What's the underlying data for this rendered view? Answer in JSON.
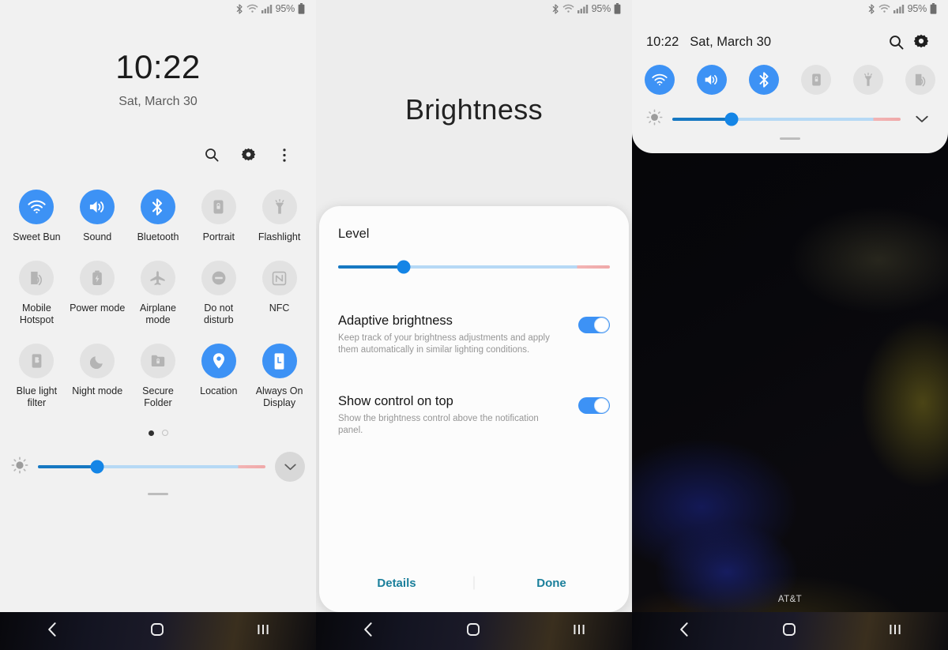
{
  "statusbar": {
    "battery_percent": "95%",
    "icons": [
      "bluetooth-icon",
      "wifi-icon",
      "signal-icon",
      "battery-icon"
    ]
  },
  "panel1": {
    "name": "expanded-quick-settings",
    "clock_time": "10:22",
    "clock_date": "Sat, March 30",
    "actions": [
      {
        "name": "search-icon",
        "label": "Search"
      },
      {
        "name": "gear-icon",
        "label": "Settings"
      },
      {
        "name": "overflow-menu-icon",
        "label": "More options"
      }
    ],
    "tiles": [
      {
        "label": "Sweet Bun",
        "icon": "wifi-icon",
        "on": true
      },
      {
        "label": "Sound",
        "icon": "sound-icon",
        "on": true
      },
      {
        "label": "Bluetooth",
        "icon": "bluetooth-icon",
        "on": true
      },
      {
        "label": "Portrait",
        "icon": "rotation-lock-icon",
        "on": false
      },
      {
        "label": "Flashlight",
        "icon": "flashlight-icon",
        "on": false
      },
      {
        "label": "Mobile Hotspot",
        "icon": "hotspot-icon",
        "on": false
      },
      {
        "label": "Power mode",
        "icon": "power-mode-icon",
        "on": false
      },
      {
        "label": "Airplane mode",
        "icon": "airplane-icon",
        "on": false
      },
      {
        "label": "Do not disturb",
        "icon": "do-not-disturb-icon",
        "on": false
      },
      {
        "label": "NFC",
        "icon": "nfc-icon",
        "on": false
      },
      {
        "label": "Blue light filter",
        "icon": "blue-light-filter-icon",
        "on": false
      },
      {
        "label": "Night mode",
        "icon": "moon-icon",
        "on": false
      },
      {
        "label": "Secure Folder",
        "icon": "secure-folder-icon",
        "on": false
      },
      {
        "label": "Location",
        "icon": "location-pin-icon",
        "on": true
      },
      {
        "label": "Always On Display",
        "icon": "always-on-display-icon",
        "on": true
      }
    ],
    "page_dots": {
      "count": 2,
      "active_index": 0
    },
    "brightness": {
      "value_percent": 26,
      "icon": "brightness-icon"
    },
    "expand_button": {
      "name": "expand-chevron-down-icon"
    }
  },
  "panel2": {
    "name": "brightness-dialog",
    "title": "Brightness",
    "level_label": "Level",
    "level_percent": 24,
    "settings": [
      {
        "title": "Adaptive brightness",
        "description": "Keep track of your brightness adjustments and apply them automatically in similar lighting conditions.",
        "enabled": true
      },
      {
        "title": "Show control on top",
        "description": "Show the brightness control above the notification panel.",
        "enabled": true
      }
    ],
    "buttons": {
      "details": "Details",
      "done": "Done"
    }
  },
  "panel3": {
    "name": "collapsed-quick-settings",
    "time": "10:22",
    "date": "Sat, March 30",
    "header_actions": [
      {
        "name": "search-icon",
        "label": "Search"
      },
      {
        "name": "gear-icon",
        "label": "Settings"
      }
    ],
    "tiles": [
      {
        "label": "Wi-Fi",
        "icon": "wifi-icon",
        "on": true
      },
      {
        "label": "Sound",
        "icon": "sound-icon",
        "on": true
      },
      {
        "label": "Bluetooth",
        "icon": "bluetooth-icon",
        "on": true
      },
      {
        "label": "Portrait",
        "icon": "rotation-lock-icon",
        "on": false
      },
      {
        "label": "Flashlight",
        "icon": "flashlight-icon",
        "on": false
      },
      {
        "label": "Mobile Hotspot",
        "icon": "hotspot-icon",
        "on": false
      }
    ],
    "brightness": {
      "value_percent": 26,
      "icon": "brightness-icon"
    },
    "collapse_button": {
      "name": "chevron-down-icon"
    },
    "carrier": "AT&T"
  },
  "navbar": {
    "back": "back-icon",
    "home": "home-icon",
    "recents": "recents-icon"
  },
  "colors": {
    "accent_blue": "#3d92f5",
    "slider_fill": "#1678c2",
    "slider_thumb": "#1485e6",
    "slider_track": "#b6d9f5",
    "slider_warm": "#f0a9a9",
    "panel_bg": "#f1f1f1",
    "dialog_bg": "#fcfcfc",
    "dialog_link": "#1a7f9b",
    "tile_off_bg": "#e2e2e2",
    "tile_off_fg": "#b0b0b0"
  }
}
